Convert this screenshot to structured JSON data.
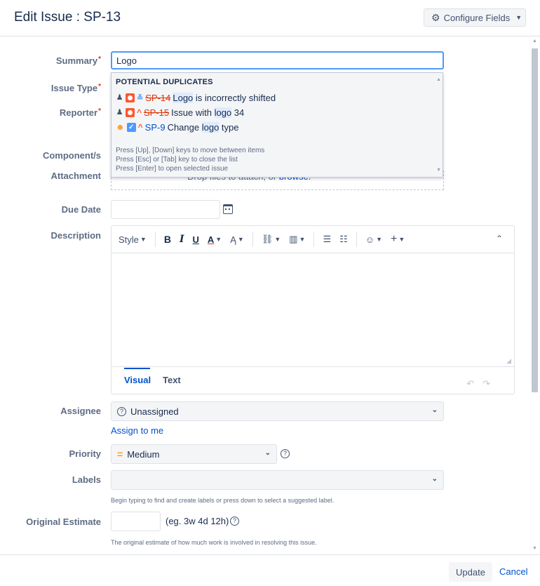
{
  "header": {
    "title": "Edit Issue : SP-13",
    "configure_label": "Configure Fields"
  },
  "fields": {
    "summary_label": "Summary",
    "summary_value": "Logo",
    "issue_type_label": "Issue Type",
    "reporter_label": "Reporter",
    "component_label": "Component/s",
    "attachment_label": "Attachment",
    "attachment_text": "Drop files to attach, or",
    "attachment_link": "browse.",
    "due_date_label": "Due Date",
    "description_label": "Description",
    "assignee_label": "Assignee",
    "assignee_value": "Unassigned",
    "assign_to_me": "Assign to me",
    "priority_label": "Priority",
    "priority_value": "Medium",
    "labels_label": "Labels",
    "labels_hint": "Begin typing to find and create labels or press down to select a suggested label.",
    "estimate_label": "Original Estimate",
    "estimate_format": "(eg. 3w 4d 12h)",
    "estimate_hint": "The original estimate of how much work is involved in resolving this issue."
  },
  "duplicates": {
    "heading": "POTENTIAL DUPLICATES",
    "items": [
      {
        "key": "SP-14",
        "pre": "",
        "match": "Logo",
        "post": " is incorrectly shifted",
        "resolved": true
      },
      {
        "key": "SP-15",
        "pre": "Issue with ",
        "match": "logo",
        "post": " 34",
        "resolved": true
      },
      {
        "key": "SP-9",
        "pre": "Change ",
        "match": "logo",
        "post": " type",
        "resolved": false
      }
    ],
    "tips": [
      "Press [Up], [Down] keys to move between items",
      "Press [Esc] or [Tab] key to close the list",
      "Press [Enter] to open selected issue"
    ]
  },
  "editor": {
    "style_label": "Style",
    "bold": "B",
    "italic": "I",
    "underline": "U",
    "text_color": "A",
    "tab_visual": "Visual",
    "tab_text": "Text"
  },
  "footer": {
    "update_label": "Update",
    "cancel_label": "Cancel"
  },
  "colors": {
    "accent": "#0052cc",
    "focus_border": "#4c9aff",
    "required": "#de350b"
  }
}
